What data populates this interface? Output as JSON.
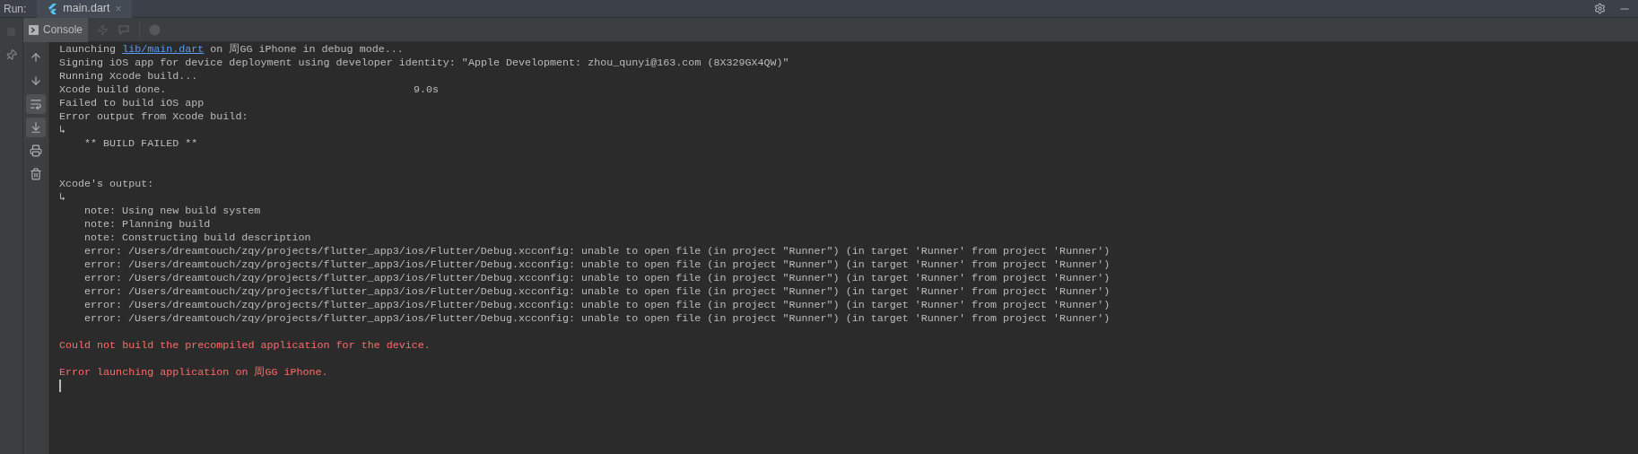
{
  "run_bar": {
    "label": "Run:",
    "tabs": [
      {
        "label": "main.dart",
        "close": "×",
        "selected": true
      }
    ]
  },
  "console_tab": {
    "label": "Console",
    "selected": true
  },
  "side_tools": [
    {
      "kind": "up",
      "selected": false
    },
    {
      "kind": "down",
      "selected": false
    },
    {
      "kind": "wrap",
      "selected": true
    },
    {
      "kind": "scroll-end",
      "selected": true
    },
    {
      "kind": "print",
      "selected": false
    },
    {
      "kind": "trash",
      "selected": false
    }
  ],
  "lines": [
    {
      "kind": "link",
      "before": "Launching ",
      "link": "lib/main.dart",
      "after": " on 周GG iPhone in debug mode..."
    },
    {
      "kind": "plain",
      "text": "Signing iOS app for device deployment using developer identity: \"Apple Development: zhou_qunyi@163.com (8X329GX4QW)\""
    },
    {
      "kind": "plain",
      "text": "Running Xcode build..."
    },
    {
      "kind": "timed",
      "text": "Xcode build done.",
      "time": "9.0s"
    },
    {
      "kind": "plain",
      "text": "Failed to build iOS app"
    },
    {
      "kind": "plain",
      "text": "Error output from Xcode build:"
    },
    {
      "kind": "plain",
      "text": "↳"
    },
    {
      "kind": "indented",
      "text": "** BUILD FAILED **"
    },
    {
      "kind": "gap"
    },
    {
      "kind": "gap"
    },
    {
      "kind": "plain",
      "text": "Xcode's output:"
    },
    {
      "kind": "plain",
      "text": "↳"
    },
    {
      "kind": "indented",
      "text": "note: Using new build system"
    },
    {
      "kind": "indented",
      "text": "note: Planning build"
    },
    {
      "kind": "indented",
      "text": "note: Constructing build description"
    },
    {
      "kind": "indented",
      "text": "error: /Users/dreamtouch/zqy/projects/flutter_app3/ios/Flutter/Debug.xcconfig: unable to open file (in project \"Runner\") (in target 'Runner' from project 'Runner')"
    },
    {
      "kind": "indented",
      "text": "error: /Users/dreamtouch/zqy/projects/flutter_app3/ios/Flutter/Debug.xcconfig: unable to open file (in project \"Runner\") (in target 'Runner' from project 'Runner')"
    },
    {
      "kind": "indented",
      "text": "error: /Users/dreamtouch/zqy/projects/flutter_app3/ios/Flutter/Debug.xcconfig: unable to open file (in project \"Runner\") (in target 'Runner' from project 'Runner')"
    },
    {
      "kind": "indented",
      "text": "error: /Users/dreamtouch/zqy/projects/flutter_app3/ios/Flutter/Debug.xcconfig: unable to open file (in project \"Runner\") (in target 'Runner' from project 'Runner')"
    },
    {
      "kind": "indented",
      "text": "error: /Users/dreamtouch/zqy/projects/flutter_app3/ios/Flutter/Debug.xcconfig: unable to open file (in project \"Runner\") (in target 'Runner' from project 'Runner')"
    },
    {
      "kind": "indented",
      "text": "error: /Users/dreamtouch/zqy/projects/flutter_app3/ios/Flutter/Debug.xcconfig: unable to open file (in project \"Runner\") (in target 'Runner' from project 'Runner')"
    },
    {
      "kind": "gap"
    },
    {
      "kind": "error",
      "text": "Could not build the precompiled application for the device."
    },
    {
      "kind": "gap"
    },
    {
      "kind": "error",
      "text": "Error launching application on 周GG iPhone."
    },
    {
      "kind": "cursor"
    }
  ]
}
